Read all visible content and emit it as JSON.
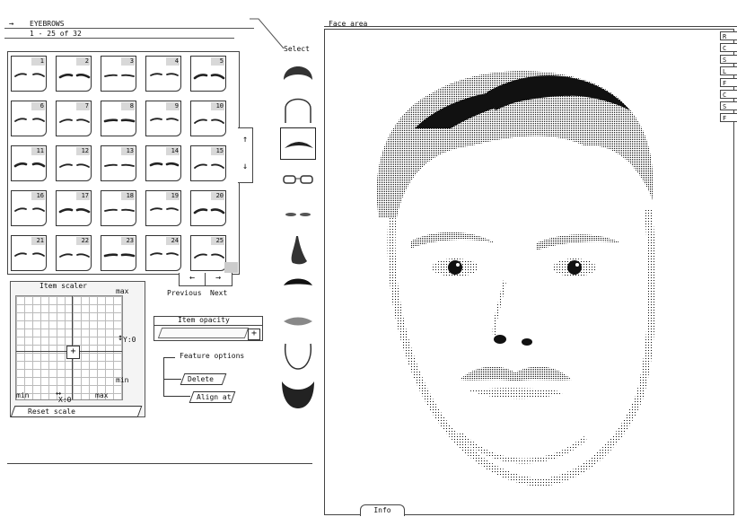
{
  "header": {
    "arrow": "→",
    "category": "EYEBROWS",
    "range": "1 - 25 of 32"
  },
  "grid": {
    "items": [
      "1",
      "2",
      "3",
      "4",
      "5",
      "6",
      "7",
      "8",
      "9",
      "10",
      "11",
      "12",
      "13",
      "14",
      "15",
      "16",
      "17",
      "18",
      "19",
      "20",
      "21",
      "22",
      "23",
      "24",
      "25"
    ]
  },
  "scroll": {
    "up": "↑",
    "down": "↓"
  },
  "pager": {
    "prev_arrow": "←",
    "next_arrow": "→",
    "prev_label": "Previous",
    "next_label": "Next"
  },
  "select": {
    "label": "Select",
    "items": [
      "hair",
      "face-shape",
      "eyebrows",
      "glasses",
      "eyes",
      "nose",
      "moustache",
      "mouth",
      "chin",
      "beard"
    ]
  },
  "scaler": {
    "title": "Item scaler",
    "max": "max",
    "min": "min",
    "x_readout": "X:0",
    "y_readout": "Y:0",
    "reset": "Reset scale"
  },
  "opacity": {
    "label": "Item opacity"
  },
  "feature_options": {
    "title": "Feature options",
    "delete": "Delete",
    "align": "Align at"
  },
  "face": {
    "title": "Face area",
    "info_tab": "Info",
    "side_tabs": [
      "R",
      "C",
      "S",
      "L",
      "F",
      "C",
      "S",
      "F"
    ]
  },
  "colors": {
    "ink": "#111111",
    "panel": "#f4f4f4",
    "tab": "#d8d8d8"
  }
}
